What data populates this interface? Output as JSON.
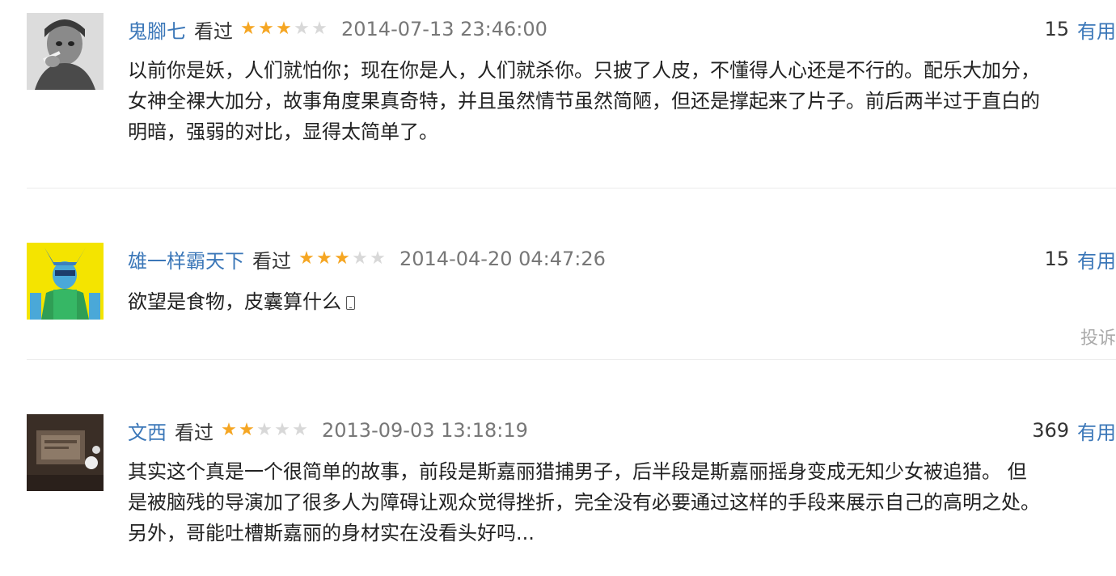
{
  "colors": {
    "link": "#3b77b8",
    "star_on": "#f5a623",
    "star_off": "#d8d8d8"
  },
  "comments": [
    {
      "user": "鬼腳七",
      "status": "看过",
      "rating": 3,
      "time": "2014-07-13 23:46:00",
      "votes": "15",
      "useful_label": "有用",
      "text": "以前你是妖，人们就怕你；现在你是人，人们就杀你。只披了人皮，不懂得人心还是不行的。配乐大加分，\n女神全裸大加分，故事角度果真奇特，并且虽然情节虽然简陋，但还是撑起来了片子。前后两半过于直白的\n明暗，强弱的对比，显得太简单了。"
    },
    {
      "user": "雄一样霸天下",
      "status": "看过",
      "rating": 3,
      "time": "2014-04-20 04:47:26",
      "votes": "15",
      "useful_label": "有用",
      "text": "欲望是食物，皮囊算什么",
      "report_label": "投诉"
    },
    {
      "user": "文西",
      "status": "看过",
      "rating": 2,
      "time": "2013-09-03 13:18:19",
      "votes": "369",
      "useful_label": "有用",
      "text": "其实这个真是一个很简单的故事，前段是斯嘉丽猎捕男子，后半段是斯嘉丽摇身变成无知少女被追猎。 但\n是被脑残的导演加了很多人为障碍让观众觉得挫折，完全没有必要通过这样的手段来展示自己的高明之处。\n另外，哥能吐槽斯嘉丽的身材实在没看头好吗..."
    }
  ]
}
